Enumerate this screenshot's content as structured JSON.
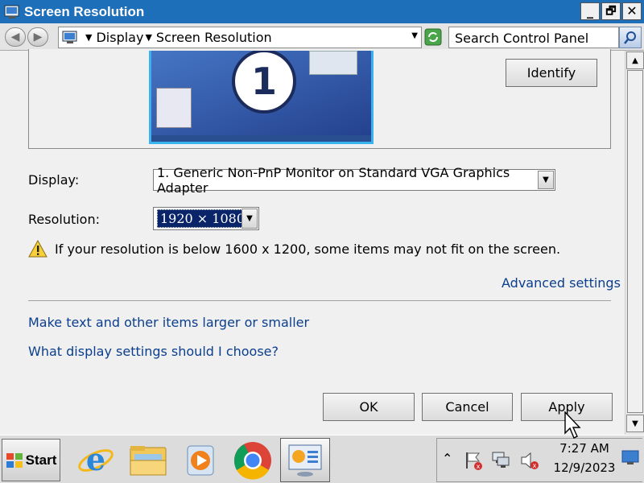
{
  "window": {
    "title": "Screen Resolution",
    "controls": {
      "minimize": "_",
      "maximize": "🗗",
      "close": "✕"
    }
  },
  "address_bar": {
    "breadcrumb": [
      "Display",
      "Screen Resolution"
    ],
    "search_placeholder": "Search Control Panel"
  },
  "monitor_preview": {
    "number": "1",
    "identify_label": "Identify"
  },
  "settings": {
    "display_label": "Display:",
    "display_value": "1. Generic Non-PnP Monitor on Standard VGA Graphics Adapter",
    "resolution_label": "Resolution:",
    "resolution_value": "1920 × 1080",
    "warning_text": "If your resolution is below 1600 x 1200, some items may not fit on the screen.",
    "advanced_link": "Advanced settings"
  },
  "links": {
    "text_size": "Make text and other items larger or smaller",
    "help": "What display settings should I choose?"
  },
  "buttons": {
    "ok": "OK",
    "cancel": "Cancel",
    "apply": "Apply"
  },
  "taskbar": {
    "start_label": "Start",
    "apps": [
      "internet-explorer",
      "file-explorer",
      "media-player",
      "chrome",
      "screen-resolution"
    ],
    "clock_time": "7:27 AM",
    "clock_date": "12/9/2023"
  },
  "colors": {
    "title_bar": "#1c6fb8",
    "link": "#0b3e8c",
    "selection": "#0a246a"
  }
}
